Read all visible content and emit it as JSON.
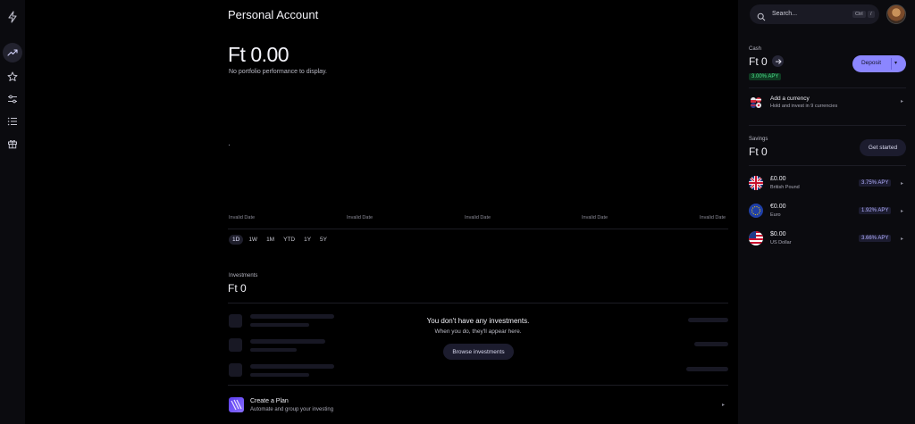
{
  "header": {
    "title": "Personal Account"
  },
  "portfolio": {
    "value": "Ft 0.00",
    "note": "No portfolio performance to display.",
    "x_labels": [
      "Invalid Date",
      "Invalid Date",
      "Invalid Date",
      "Invalid Date",
      "Invalid Date"
    ],
    "ranges": [
      "1D",
      "1W",
      "1M",
      "YTD",
      "1Y",
      "5Y"
    ],
    "active_range": "1D"
  },
  "investments": {
    "label": "Investments",
    "value": "Ft 0",
    "empty_title": "You don't have any investments.",
    "empty_sub": "When you do, they'll appear here.",
    "browse_label": "Browse investments"
  },
  "plan": {
    "title": "Create a Plan",
    "subtitle": "Automate and group your investing"
  },
  "search": {
    "placeholder": "Search...",
    "shortcut_ctrl": "Ctrl",
    "shortcut_key": "/"
  },
  "cash": {
    "label": "Cash",
    "value": "Ft 0",
    "apy": "3.00% APY",
    "deposit_label": "Deposit"
  },
  "add_currency": {
    "title": "Add a currency",
    "subtitle": "Hold and invest in 9 currencies"
  },
  "savings": {
    "label": "Savings",
    "value": "Ft 0",
    "get_started_label": "Get started",
    "currencies": [
      {
        "amount": "£0.00",
        "name": "British Pound",
        "apy": "3.75% APY"
      },
      {
        "amount": "€0.00",
        "name": "Euro",
        "apy": "1.92% APY"
      },
      {
        "amount": "$0.00",
        "name": "US Dollar",
        "apy": "3.66% APY"
      }
    ]
  },
  "colors": {
    "accent": "#8b86ff",
    "positive": "#4be08a",
    "background": "#000000",
    "panel": "#0b0b0f"
  },
  "icons": {
    "sidebar": [
      "lightning-icon",
      "trending-up-icon",
      "star-icon",
      "sliders-icon",
      "list-icon",
      "gift-icon"
    ]
  }
}
